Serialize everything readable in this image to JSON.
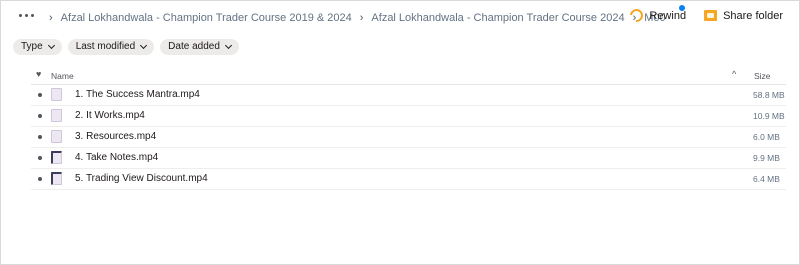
{
  "breadcrumbs": [
    "Afzal Lokhandwala - Champion Trader Course 2019 & 2024",
    "Afzal Lokhandwala - Champion Trader Course 2024",
    "M00"
  ],
  "actions": {
    "rewind_label": "Rewind",
    "share_folder_label": "Share folder"
  },
  "filters": [
    "Type",
    "Last modified",
    "Date added"
  ],
  "table": {
    "columns": {
      "name": "Name",
      "size": "Size"
    },
    "rows": [
      {
        "name": "1. The Success Mantra.mp4",
        "size": "58.8 MB",
        "icon": "video-file-icon"
      },
      {
        "name": "2. It Works.mp4",
        "size": "10.9 MB",
        "icon": "video-file-icon"
      },
      {
        "name": "3. Resources.mp4",
        "size": "6.0 MB",
        "icon": "video-file-icon"
      },
      {
        "name": "4. Take Notes.mp4",
        "size": "9.9 MB",
        "icon": "video-file-icon"
      },
      {
        "name": "5. Trading View Discount.mp4",
        "size": "6.4 MB",
        "icon": "video-file-icon"
      }
    ]
  },
  "colors": {
    "accent_rewind": "#f5a623",
    "notification_dot": "#0d7ff1",
    "chip_bg": "#ecebe9"
  }
}
